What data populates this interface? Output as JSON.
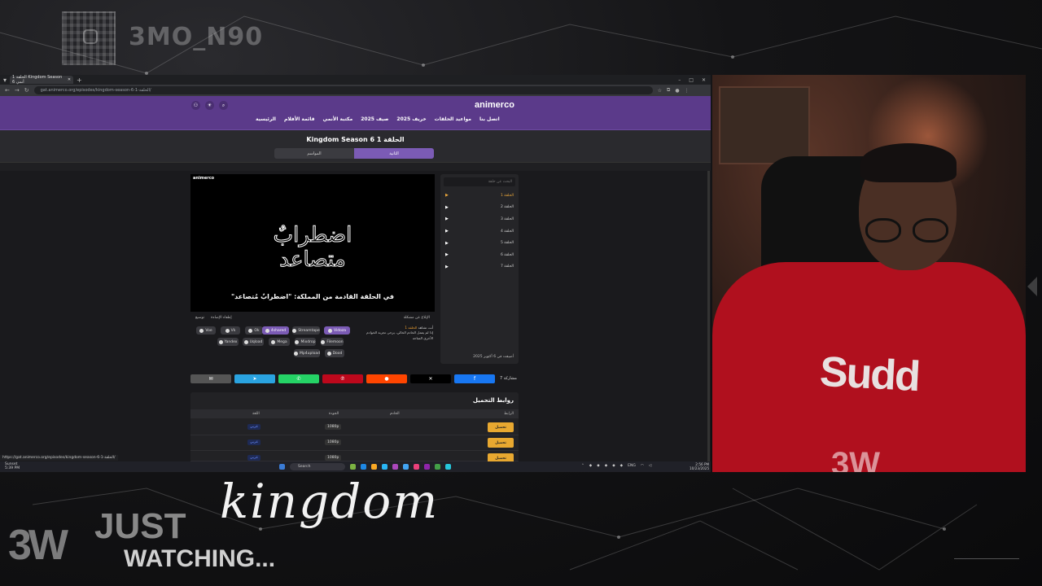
{
  "stream": {
    "handle": "3MO_N90",
    "overlay_just": "JUST",
    "overlay_watching": "WATCHING...",
    "overlay_show": "kingdom",
    "logo": "3W",
    "webcam_shirt_text": "Sudd"
  },
  "browser": {
    "tab_title": "الحلقة 1 Kingdom Season 6 أنمي",
    "url": "gat.animerco.org/episodes/kingdom-season-6-1-الحلقة/",
    "status_url": "https://gat.animerco.org/episodes/kingdom-season-6-1-الحلقة/"
  },
  "site": {
    "logo": "animerco",
    "nav": [
      "الرئيسية",
      "قائمة الأفلام",
      "مكتبة الأنمي",
      "صيف 2025",
      "خريف 2025",
      "مواعيد الحلقات",
      "اتصل بنا"
    ],
    "episode_title": "Kingdom Season 6 الحلقة 1",
    "tab_primary": "الثانية",
    "tab_secondary": "المواسم"
  },
  "player": {
    "logo": "animerco",
    "calligraphy": "اضطرابٌ متصاعد",
    "subtitle": "في الحلقة القادمة من المملكة: \"اضطرابٌ مُتصاعد\"",
    "report_label": "الإبلاغ عن مشكلة",
    "light_label": "إطفاء الإضاءة",
    "expand_label": "توسيع",
    "servers": [
      "Voe",
      "Vk",
      "Ok",
      "Mp4",
      "Mega",
      "Streamtape",
      "4shared",
      "Mp4upload",
      "Vidoza",
      "Yandex",
      "Uqload",
      "Filemoon",
      "Dood",
      "Mixdrop"
    ],
    "notice_prefix": "أنت تشاهد",
    "notice_highlight": "الحلقة 1",
    "notice_text": "إذا لم يعمل الخادم الحالي، يرجى تجربة الخوادم الأخرى المتاحة"
  },
  "episodes": {
    "search_placeholder": "البحث عن حلقة",
    "items": [
      "الحلقة 1",
      "الحلقة 2",
      "الحلقة 3",
      "الحلقة 4",
      "الحلقة 5",
      "الحلقة 6",
      "الحلقة 7"
    ],
    "date": "أضيفت في 6 أكتوبر 2025"
  },
  "share": {
    "label": "مشاركة 7",
    "buttons": [
      "facebook",
      "x",
      "reddit",
      "pinterest",
      "whatsapp",
      "telegram",
      "email"
    ],
    "colors": [
      "#1877f2",
      "#000000",
      "#ff4500",
      "#bd081c",
      "#25d366",
      "#2aa3e0",
      "#555555"
    ]
  },
  "downloads": {
    "title": "روابط التحميل",
    "headers": [
      "الرابط",
      "الخادم",
      "الجودة",
      "اللغة"
    ],
    "rows": [
      {
        "button": "تحميل",
        "quality": "1080p",
        "lang": "عربي"
      },
      {
        "button": "تحميل",
        "quality": "1080p",
        "lang": "عربي"
      },
      {
        "button": "تحميل",
        "quality": "1080p",
        "lang": "عربي"
      }
    ]
  },
  "taskbar": {
    "weather_title": "Sunset",
    "weather_time": "5:39 PM",
    "search": "Search",
    "lang": "ENG",
    "time": "2:56 PM",
    "date": "10/23/2025"
  }
}
